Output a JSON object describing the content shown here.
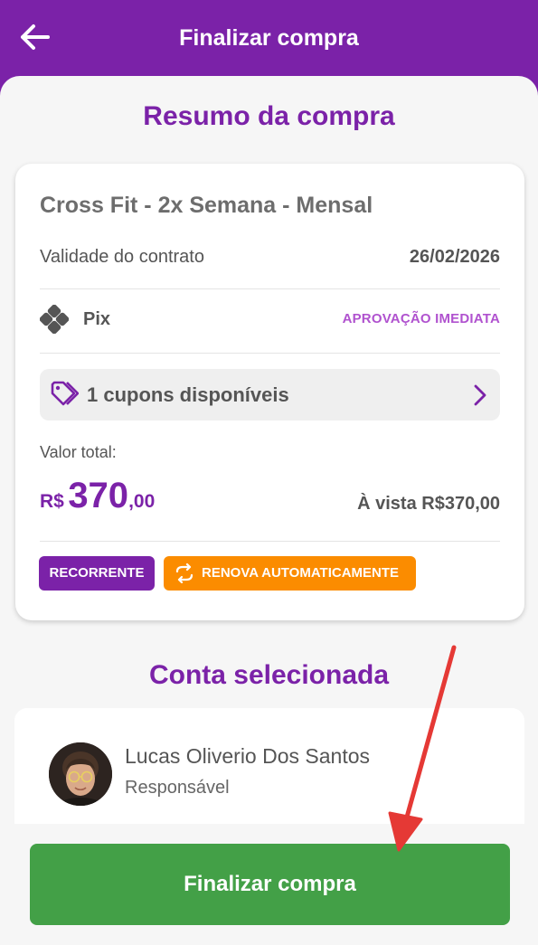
{
  "header": {
    "title": "Finalizar compra"
  },
  "summary": {
    "section_title": "Resumo da compra",
    "plan_name": "Cross Fit - 2x Semana - Mensal",
    "validity_label": "Validade do contrato",
    "validity_date": "26/02/2026",
    "payment_method": "Pix",
    "approval_text": "APROVAÇÃO IMEDIATA",
    "coupon_text": "1 cupons disponíveis",
    "total_label": "Valor total:",
    "price_currency": "R$",
    "price_integer": "370",
    "price_cents": ",00",
    "cash_text": "À vista R$370,00",
    "badge_recurring": "RECORRENTE",
    "badge_auto_renew": "RENOVA AUTOMATICAMENTE"
  },
  "account": {
    "section_title": "Conta selecionada",
    "name": "Lucas Oliverio Dos Santos",
    "role": "Responsável"
  },
  "footer": {
    "button_label": "Finalizar compra"
  },
  "icons": [
    "back-arrow-icon",
    "pix-icon",
    "tag-icon",
    "chevron-right-icon",
    "repeat-icon",
    "avatar-photo"
  ],
  "colors": {
    "primary": "#7b22a8",
    "accent_light": "#b052cf",
    "orange": "#fb8c00",
    "green": "#43a047",
    "annotation_arrow": "#e53935"
  }
}
